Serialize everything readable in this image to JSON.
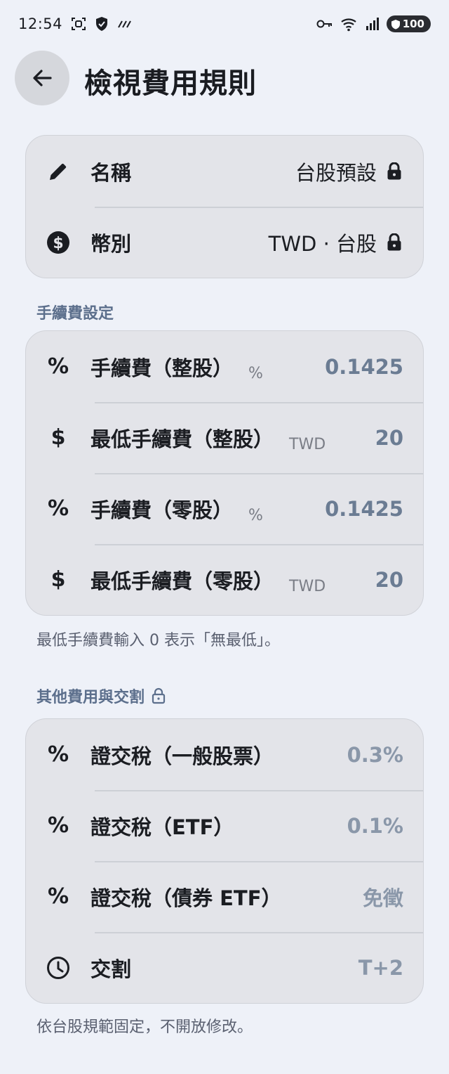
{
  "status_bar": {
    "time": "12:54",
    "battery": "100",
    "icons": [
      "screenshot-icon",
      "shield-icon",
      "signal-strength-icon",
      "key-icon",
      "wifi-icon",
      "cellular-icon",
      "battery-icon"
    ]
  },
  "app_bar": {
    "title": "檢視費用規則"
  },
  "basic": {
    "name_label": "名稱",
    "name_value": "台股預設",
    "currency_label": "幣別",
    "currency_value": "TWD · 台股"
  },
  "fees": {
    "section_title": "手續費設定",
    "rows": [
      {
        "icon": "%",
        "label": "手續費（整股）",
        "unit": "%",
        "value": "0.1425"
      },
      {
        "icon": "$",
        "label": "最低手續費（整股）",
        "unit": "TWD",
        "value": "20"
      },
      {
        "icon": "%",
        "label": "手續費（零股）",
        "unit": "%",
        "value": "0.1425"
      },
      {
        "icon": "$",
        "label": "最低手續費（零股）",
        "unit": "TWD",
        "value": "20"
      }
    ],
    "note": "最低手續費輸入 0 表示「無最低」。"
  },
  "other": {
    "section_title": "其他費用與交割",
    "rows": [
      {
        "icon": "%",
        "label": "證交稅（一般股票）",
        "value": "0.3%"
      },
      {
        "icon": "%",
        "label": "證交稅（ETF）",
        "value": "0.1%"
      },
      {
        "icon": "%",
        "label": "證交稅（債券 ETF）",
        "value": "免徵"
      },
      {
        "icon": "clock",
        "label": "交割",
        "value": "T+2"
      }
    ],
    "note": "依台股規範固定，不開放修改。"
  },
  "colors": {
    "background": "#eef1f8",
    "card": "#e3e4e9",
    "value_accent": "#6b7c93",
    "section_label": "#5c6f8c"
  }
}
